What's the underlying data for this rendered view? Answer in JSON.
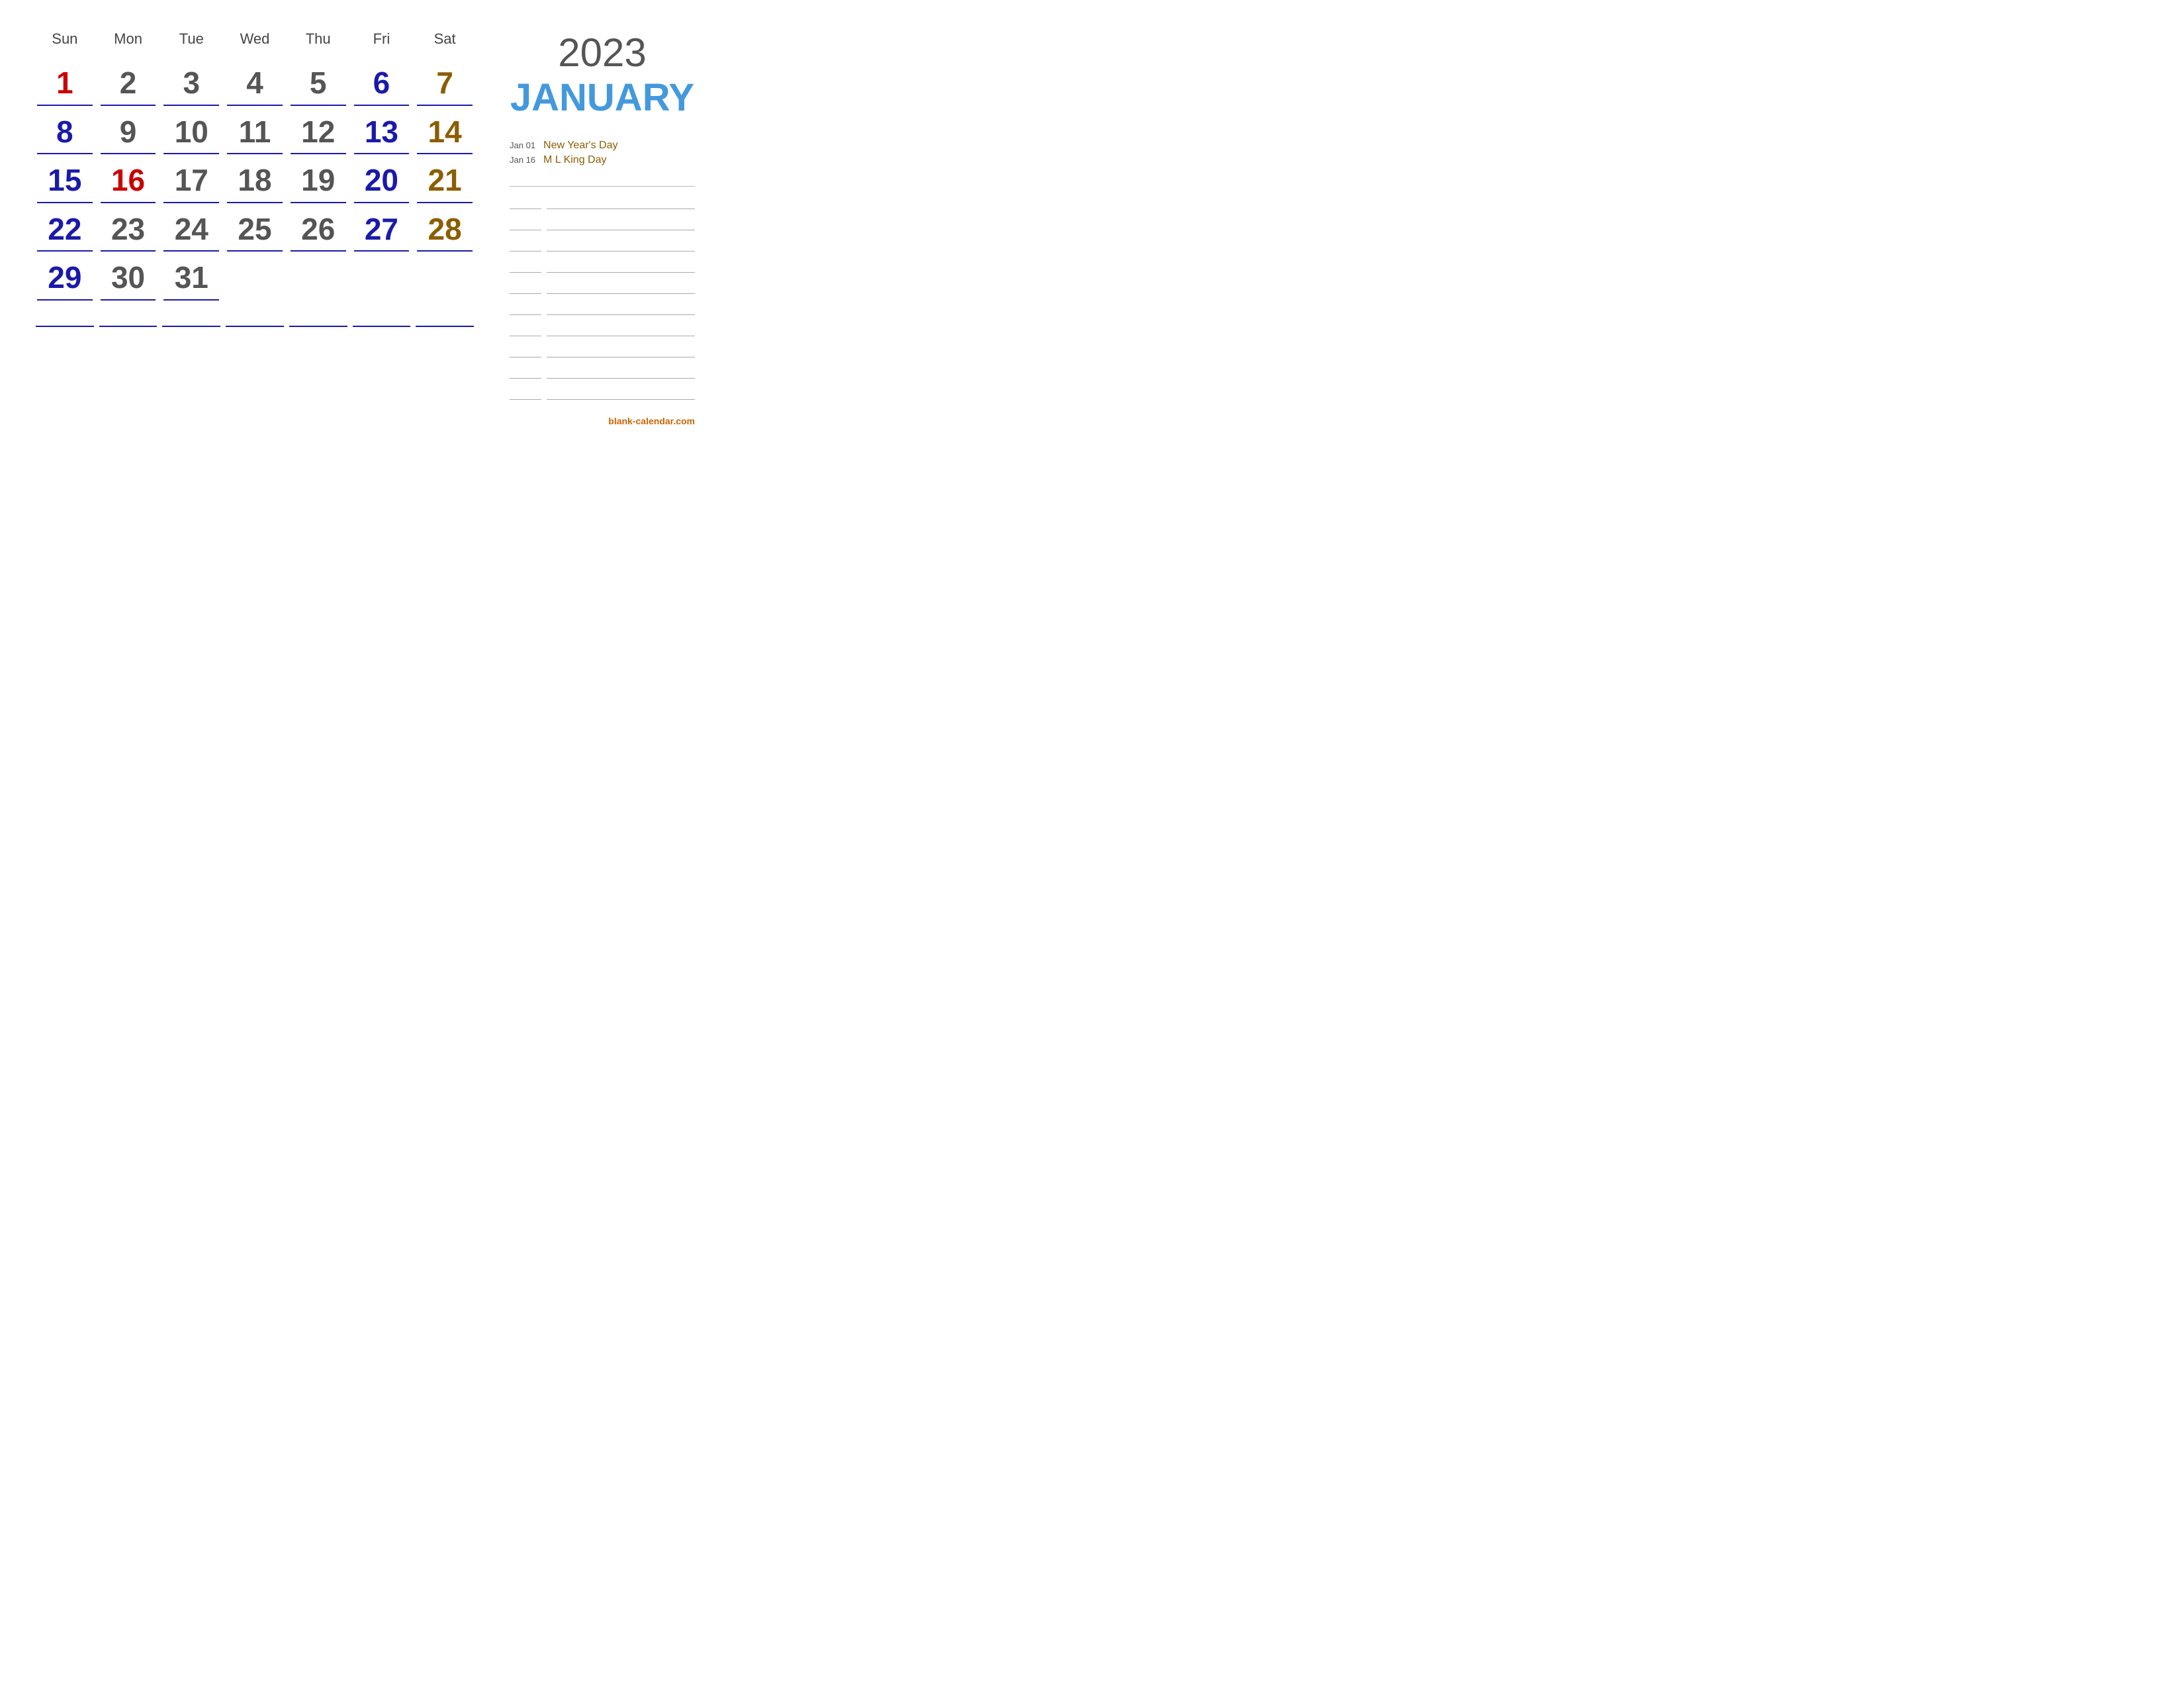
{
  "header": {
    "year": "2023",
    "month": "JANUARY"
  },
  "day_headers": [
    "Sun",
    "Mon",
    "Tue",
    "Wed",
    "Thu",
    "Fri",
    "Sat"
  ],
  "weeks": [
    [
      {
        "num": "1",
        "colorClass": "color-red",
        "empty": false
      },
      {
        "num": "2",
        "colorClass": "color-mon",
        "empty": false
      },
      {
        "num": "3",
        "colorClass": "color-tue",
        "empty": false
      },
      {
        "num": "4",
        "colorClass": "color-wed",
        "empty": false
      },
      {
        "num": "5",
        "colorClass": "color-thu",
        "empty": false
      },
      {
        "num": "6",
        "colorClass": "color-fri",
        "empty": false
      },
      {
        "num": "7",
        "colorClass": "color-sat",
        "empty": false
      }
    ],
    [
      {
        "num": "8",
        "colorClass": "color-sun",
        "empty": false
      },
      {
        "num": "9",
        "colorClass": "color-mon",
        "empty": false
      },
      {
        "num": "10",
        "colorClass": "color-tue",
        "empty": false
      },
      {
        "num": "11",
        "colorClass": "color-wed",
        "empty": false
      },
      {
        "num": "12",
        "colorClass": "color-thu",
        "empty": false
      },
      {
        "num": "13",
        "colorClass": "color-fri",
        "empty": false
      },
      {
        "num": "14",
        "colorClass": "color-sat",
        "empty": false
      }
    ],
    [
      {
        "num": "15",
        "colorClass": "color-sun",
        "empty": false
      },
      {
        "num": "16",
        "colorClass": "color-red",
        "empty": false
      },
      {
        "num": "17",
        "colorClass": "color-tue",
        "empty": false
      },
      {
        "num": "18",
        "colorClass": "color-wed",
        "empty": false
      },
      {
        "num": "19",
        "colorClass": "color-thu",
        "empty": false
      },
      {
        "num": "20",
        "colorClass": "color-fri",
        "empty": false
      },
      {
        "num": "21",
        "colorClass": "color-sat",
        "empty": false
      }
    ],
    [
      {
        "num": "22",
        "colorClass": "color-sun",
        "empty": false
      },
      {
        "num": "23",
        "colorClass": "color-mon",
        "empty": false
      },
      {
        "num": "24",
        "colorClass": "color-tue",
        "empty": false
      },
      {
        "num": "25",
        "colorClass": "color-wed",
        "empty": false
      },
      {
        "num": "26",
        "colorClass": "color-thu",
        "empty": false
      },
      {
        "num": "27",
        "colorClass": "color-fri",
        "empty": false
      },
      {
        "num": "28",
        "colorClass": "color-sat",
        "empty": false
      }
    ],
    [
      {
        "num": "29",
        "colorClass": "color-sun",
        "empty": false
      },
      {
        "num": "30",
        "colorClass": "color-mon",
        "empty": false
      },
      {
        "num": "31",
        "colorClass": "color-tue",
        "empty": false
      },
      {
        "num": "",
        "colorClass": "",
        "empty": true
      },
      {
        "num": "",
        "colorClass": "",
        "empty": true
      },
      {
        "num": "",
        "colorClass": "",
        "empty": true
      },
      {
        "num": "",
        "colorClass": "",
        "empty": true
      }
    ]
  ],
  "holidays": [
    {
      "date": "Jan 01",
      "name": "New Year's Day"
    },
    {
      "date": "Jan 16",
      "name": "M L King Day"
    }
  ],
  "notes_rows": [
    {},
    {},
    {},
    {},
    {},
    {},
    {},
    {}
  ],
  "footer": {
    "link": "blank-calendar.com"
  }
}
